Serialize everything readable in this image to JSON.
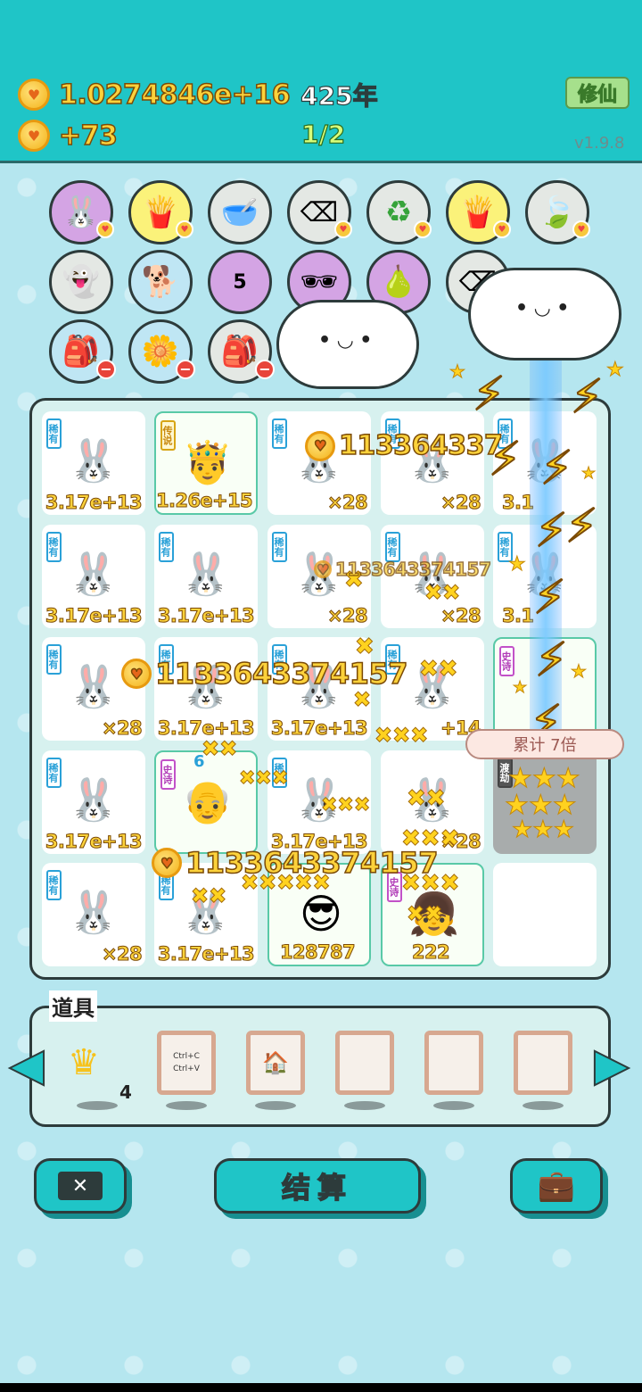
{
  "header": {
    "total_coins": "1.0274846e+16",
    "years": "425年",
    "income": "+73",
    "page": "1/2",
    "xiuxian_label": "修仙",
    "version": "v1.9.8"
  },
  "board": {
    "rows": [
      [
        {
          "rarity": "稀有",
          "value": "3.17e+13"
        },
        {
          "rarity": "传说",
          "value": "1.26e+15"
        },
        {
          "rarity": "稀有",
          "value": "×28"
        },
        {
          "rarity": "稀有",
          "value": "×28"
        },
        {
          "rarity": "稀有",
          "value": "3.1"
        }
      ],
      [
        {
          "rarity": "稀有",
          "value": "3.17e+13"
        },
        {
          "rarity": "稀有",
          "value": "3.17e+13"
        },
        {
          "rarity": "稀有",
          "value": "×28"
        },
        {
          "rarity": "稀有",
          "value": "×28"
        },
        {
          "rarity": "稀有",
          "value": "3.1"
        }
      ],
      [
        {
          "rarity": "稀有",
          "value": "×28"
        },
        {
          "rarity": "稀有",
          "value": "3.17e+13"
        },
        {
          "rarity": "稀有",
          "value": "3.17e+13"
        },
        {
          "rarity": "稀有",
          "value": "+14"
        },
        {
          "rarity": "史诗",
          "value": ""
        }
      ],
      [
        {
          "rarity": "稀有",
          "value": "3.17e+13"
        },
        {
          "rarity": "史诗",
          "value": "",
          "badge": "6"
        },
        {
          "rarity": "稀有",
          "value": "3.17e+13"
        },
        {
          "rarity": "",
          "value": "×28"
        },
        {
          "rarity": "渡劫",
          "value": ""
        }
      ],
      [
        {
          "rarity": "稀有",
          "value": "×28"
        },
        {
          "rarity": "稀有",
          "value": "3.17e+13"
        },
        {
          "rarity": "",
          "value": "128787"
        },
        {
          "rarity": "史诗",
          "value": "222"
        },
        {
          "rarity": "",
          "value": ""
        }
      ]
    ],
    "floating": [
      "113364337",
      "1133643374157",
      "1133643374157",
      "1133643374157"
    ],
    "multiplier_pill": "累计 7倍"
  },
  "items": {
    "title": "道具",
    "crown_count": "4",
    "copy_label_1": "Ctrl+C",
    "copy_label_2": "Ctrl+V"
  },
  "buttons": {
    "settle": "结算"
  },
  "icons": {
    "row1": [
      "rabbit-icon",
      "fries-icon",
      "dog-bowl-icon",
      "delete-tag-icon",
      "recycle-icon",
      "fries-icon",
      "leaf-icon"
    ],
    "row2": [
      "ghost-icon",
      "dog-icon",
      "calendar-icon",
      "sunglasses-fruit-icon",
      "pear-icon",
      "delete-tag-icon"
    ],
    "row3": [
      "seed-bag-icon",
      "flower-pot-icon",
      "seed-bag-icon"
    ],
    "calendar_day": "5"
  },
  "colors": {
    "header_bg": "#1fc5c7",
    "gold": "#fcd23b",
    "background": "#b5e6ef"
  }
}
